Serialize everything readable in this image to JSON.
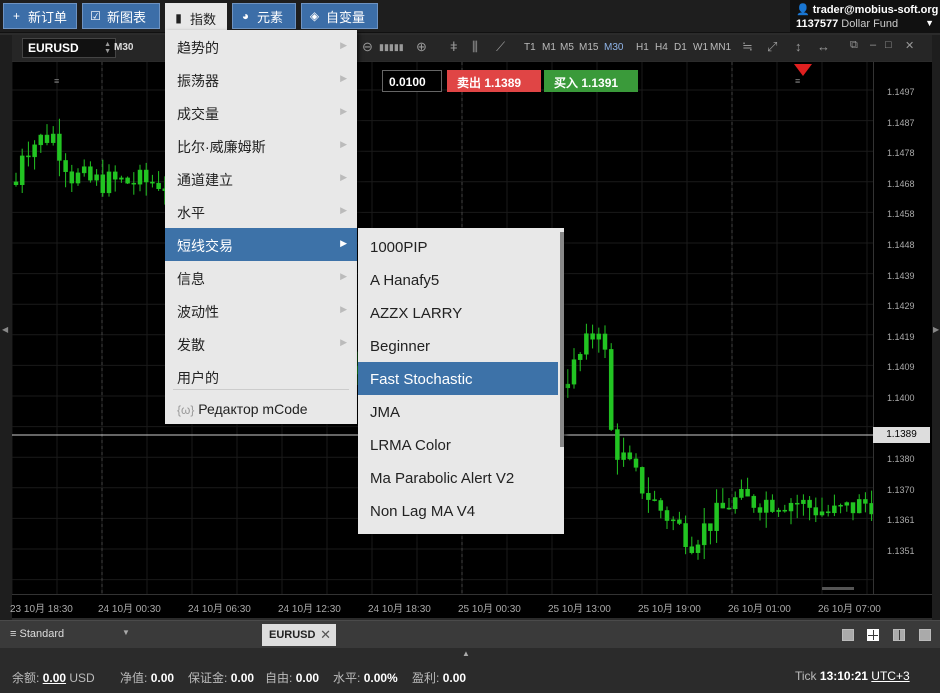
{
  "topbar": {
    "new_order": "新订单",
    "new_chart": "新图表",
    "indicators": "指数",
    "elements": "元素",
    "custom_var": "自变量"
  },
  "account": {
    "user": "trader@mobius-soft.org",
    "id": "1137577",
    "fund": "Dollar Fund"
  },
  "toolbar": {
    "symbol": "EURUSD",
    "timeframe": "M30",
    "timeframes": [
      "T1",
      "M1",
      "M5",
      "M15",
      "M30",
      "H1",
      "H4",
      "D1",
      "W1",
      "MN1"
    ],
    "selected_timeframe": "M30"
  },
  "trade": {
    "lot": "0.0100",
    "sell_label": "卖出",
    "sell_price": "1.1389",
    "buy_label": "买入",
    "buy_price": "1.1391"
  },
  "price_axis": [
    "1.1497",
    "1.1487",
    "1.1478",
    "1.1468",
    "1.1458",
    "1.1448",
    "1.1439",
    "1.1429",
    "1.1419",
    "1.1409",
    "1.1400",
    "1.1389",
    "1.1380",
    "1.1370",
    "1.1361",
    "1.1351"
  ],
  "current_price": "1.1389",
  "time_axis": [
    "23 10月 18:30",
    "24 10月 00:30",
    "24 10月 06:30",
    "24 10月 12:30",
    "24 10月 18:30",
    "25 10月 00:30",
    "25 10月 13:00",
    "25 10月 19:00",
    "26 10月 01:00",
    "26 10月 07:00"
  ],
  "indicator_menu": {
    "items": [
      "趋势的",
      "振荡器",
      "成交量",
      "比尔·威廉姆斯",
      "通道建立",
      "水平",
      "短线交易",
      "信息",
      "波动性",
      "发散",
      "用户的"
    ],
    "highlighted": "短线交易",
    "editor": "Редактор mCode"
  },
  "scalping_menu": {
    "items": [
      "1000PIP",
      "A Hanafy5",
      "AZZX LARRY",
      "Beginner",
      "Fast Stochastic",
      "JMA",
      "LRMA Color",
      "Ma Parabolic Alert V2",
      "Non Lag MA V4"
    ],
    "highlighted": "Fast Stochastic"
  },
  "workspace": {
    "name": "Standard",
    "chart_tab": "EURUSD"
  },
  "status": {
    "balance_label": "余额:",
    "balance": "0.00",
    "currency": "USD",
    "equity_label": "净值:",
    "equity": "0.00",
    "margin_label": "保证金:",
    "margin": "0.00",
    "free_label": "自由:",
    "free": "0.00",
    "level_label": "水平:",
    "level": "0.00%",
    "profit_label": "盈利:",
    "profit": "0.00",
    "tick_label": "Tick",
    "time": "13:10:21",
    "tz": "UTC+3"
  },
  "colors": {
    "bull": "#22c422",
    "bear": "#22c422",
    "sell": "#e04545",
    "buy": "#3a9a3a",
    "menu_highlight": "#3d72a8"
  }
}
